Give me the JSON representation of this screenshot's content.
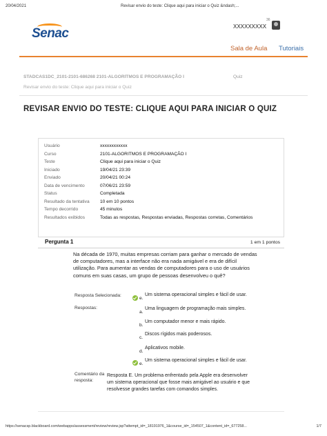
{
  "print": {
    "date": "20/04/2021",
    "title": "Revisar envio do teste: Clique aqui para iniciar o Quiz &ndash;...",
    "url": "https://senacsp.blackboard.com/webapps/assessment/review/review.jsp?attempt_id=_18191976_1&course_id=_154507_1&content_id=_677258...",
    "page": "1/7"
  },
  "brand": {
    "name": "Senac",
    "color": "#1d4f91",
    "accent": "#f7941d"
  },
  "user": {
    "name": "XXXXXXXXX",
    "notifications": "36"
  },
  "nav": {
    "tabs": [
      "Sala de Aula",
      "Tutoriais"
    ],
    "active_color": "#c0622b",
    "link_color": "#3a6ea8"
  },
  "breadcrumb": {
    "course": "STADCAS1DC_2101-2101-686268 2101-ALGORITMOS E PROGRAMAÇÃO I",
    "section": "Quiz",
    "current": "Revisar envio do teste: Clique aqui para iniciar o Quiz"
  },
  "page_title": "REVISAR ENVIO DO TESTE: CLIQUE AQUI PARA INICIAR O QUIZ",
  "info": [
    {
      "k": "Usuário",
      "v": "xxxxxxxxxxxx"
    },
    {
      "k": "Curso",
      "v": "2101-ALGORITMOS E PROGRAMAÇÃO I"
    },
    {
      "k": "Teste",
      "v": "Clique aqui para iniciar o Quiz"
    },
    {
      "k": "Iniciado",
      "v": "19/04/21 23:39"
    },
    {
      "k": "Enviado",
      "v": "20/04/21 00:24"
    },
    {
      "k": "Data de vencimento",
      "v": "07/06/21 23:59"
    },
    {
      "k": "Status",
      "v": "Completada"
    },
    {
      "k": "Resultado da tentativa",
      "v": "10 em 10 pontos"
    },
    {
      "k": "Tempo decorrido",
      "v": "45 minutos"
    },
    {
      "k": "Resultados exibidos",
      "v": "Todas as respostas, Respostas enviadas, Respostas corretas, Comentários"
    }
  ],
  "question": {
    "title": "Pergunta 1",
    "points": "1 em 1 pontos",
    "text_lines": [
      "Na década de 1970, muitas empresas corriam para ganhar o mercado de vendas",
      "de computadores, mas a interface não era nada amigável e era de difícil",
      "utilização. Para aumentar as vendas de computadores para o uso de usuários",
      "comuns em suas casas, um grupo de pessoas desenvolveu o quê?"
    ],
    "selected_label": "Resposta Selecionada:",
    "answers_label": "Respostas:",
    "selected": {
      "letter": "e.",
      "text": "Um sistema operacional simples e fácil de usar."
    },
    "options": [
      {
        "letter": "a.",
        "text": "Uma linguagem de programação mais simples."
      },
      {
        "letter": "b.",
        "text": "Um computador menor e mais rápido."
      },
      {
        "letter": "c.",
        "text": "Discos rígidos mais poderosos."
      },
      {
        "letter": "d.",
        "text": "Aplicativos mobile."
      },
      {
        "letter": "e.",
        "text": "Um sistema operacional simples e fácil de usar."
      }
    ],
    "comment_label": "Comentário da resposta:",
    "comment_lines": [
      "Resposta E. Um problema enfrentado pela Apple era desenvolver",
      "um sistema operacional que fosse mais amigável ao usuário e que",
      "resolvesse grandes tarefas com comandos simples."
    ]
  }
}
